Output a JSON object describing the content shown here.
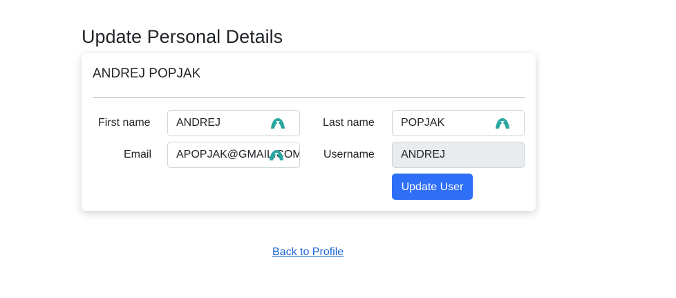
{
  "page": {
    "title": "Update Personal Details"
  },
  "card": {
    "user_heading": "ANDREJ POPJAK"
  },
  "form": {
    "first_name": {
      "label": "First name",
      "value": "ANDREJ",
      "icon": "password-manager-icon"
    },
    "last_name": {
      "label": "Last name",
      "value": "POPJAK",
      "icon": "password-manager-icon"
    },
    "email": {
      "label": "Email",
      "value": "APOPJAK@GMAIL.COM",
      "icon": "password-manager-icon"
    },
    "username": {
      "label": "Username",
      "value": "ANDREJ",
      "readonly": true
    },
    "submit_label": "Update User"
  },
  "footer": {
    "back_link": "Back to Profile"
  },
  "colors": {
    "primary_button": "#2f6ff7",
    "link": "#1b62d8",
    "icon_teal": "#2aa6a0",
    "readonly_bg": "#e9ecef"
  }
}
